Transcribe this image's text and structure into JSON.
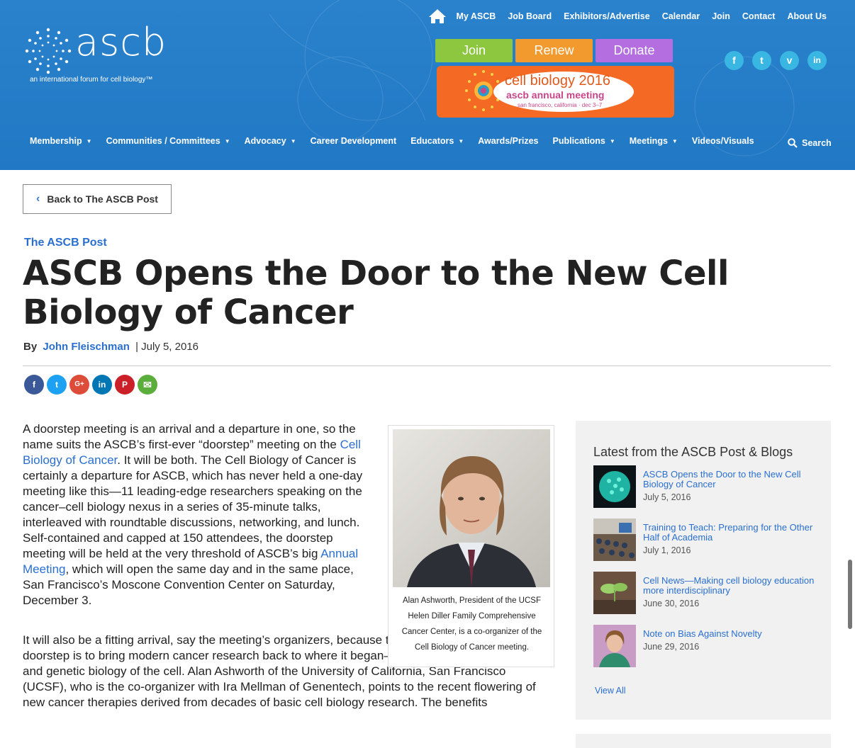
{
  "header": {
    "logo": {
      "word": "ascb",
      "tagline": "an international forum for cell biology™"
    },
    "top_nav": [
      "My ASCB",
      "Job Board",
      "Exhibitors/Advertise",
      "Calendar",
      "Join",
      "Contact",
      "About Us"
    ],
    "cta": {
      "join": "Join",
      "renew": "Renew",
      "donate": "Donate"
    },
    "banner": {
      "line1": "cell biology 2016",
      "line2": "ascb annual meeting",
      "line3": "san francisco, california · dec 3–7"
    },
    "social": [
      "facebook-icon",
      "twitter-icon",
      "vimeo-icon",
      "linkedin-icon"
    ],
    "main_nav": [
      {
        "label": "Membership",
        "dropdown": true
      },
      {
        "label": "Communities / Committees",
        "dropdown": true
      },
      {
        "label": "Advocacy",
        "dropdown": true
      },
      {
        "label": "Career Development",
        "dropdown": false
      },
      {
        "label": "Educators",
        "dropdown": true
      },
      {
        "label": "Awards/Prizes",
        "dropdown": false
      },
      {
        "label": "Publications",
        "dropdown": true
      },
      {
        "label": "Meetings",
        "dropdown": true
      },
      {
        "label": "Videos/Visuals",
        "dropdown": false
      }
    ],
    "search_label": "Search"
  },
  "back_button": "Back to The ASCB Post",
  "article": {
    "section": "The ASCB Post",
    "title": "ASCB Opens the Door to the New Cell Biology of Cancer",
    "by": "By",
    "author": "John Fleischman",
    "date": "| July 5, 2016",
    "p1_a": "A doorstep meeting is an arrival and a departure in one, so the name suits the ASCB’s first-ever “doorstep” meeting on the ",
    "p1_link1": "Cell Biology of Cancer",
    "p1_b": ". It will be both. The Cell Biology of Cancer is certainly a departure for ASCB, which has never held a one-day meeting like this—11 leading-edge researchers speaking on the cancer–cell biology nexus in a series of 35-minute talks, interleaved with roundtable discussions, networking, and lunch. Self-contained and capped at 150 attendees, the doorstep meeting will be held at the very threshold of ASCB’s big ",
    "p1_link2": "Annual Meeting",
    "p1_c": ", which will open the same day and in the same place, San Francisco’s Moscone Convention Center on Saturday, December 3.",
    "p2": "It will also be a fitting arrival, say the meeting’s organizers, because the concept behind the ASCB doorstep is to bring modern cancer research back to where it began—in the molecular, cellular, and genetic biology of the cell. Alan Ashworth of the University of California, San Francisco (UCSF), who is the co-organizer with Ira Mellman of Genentech, points to the recent flowering of new cancer therapies derived from decades of basic cell biology research. The benefits",
    "photo_caption": "Alan Ashworth, President of the UCSF Helen Diller Family Comprehensive Cancer Center, is a co-organizer of the Cell Biology of Cancer meeting."
  },
  "share_icons": [
    {
      "icon": "facebook-icon",
      "glyph": "f",
      "color": "#3b5998"
    },
    {
      "icon": "twitter-icon",
      "glyph": "t",
      "color": "#1da1f2"
    },
    {
      "icon": "google-plus-icon",
      "glyph": "G+",
      "color": "#dd4b39"
    },
    {
      "icon": "linkedin-icon",
      "glyph": "in",
      "color": "#0077b5"
    },
    {
      "icon": "pinterest-icon",
      "glyph": "P",
      "color": "#cb2027"
    },
    {
      "icon": "email-icon",
      "glyph": "✉",
      "color": "#5cae3c"
    }
  ],
  "sidebar": {
    "title": "Latest from the ASCB Post & Blogs",
    "posts": [
      {
        "title": "ASCB Opens the Door to the New Cell Biology of Cancer",
        "date": "July 5, 2016"
      },
      {
        "title": "Training to Teach: Preparing for the Other Half of Academia",
        "date": "July 1, 2016"
      },
      {
        "title": "Cell News—Making cell biology education more interdisciplinary",
        "date": "June 30, 2016"
      },
      {
        "title": "Note on Bias Against Novelty",
        "date": "June 29, 2016"
      }
    ],
    "view_all": "View All"
  }
}
